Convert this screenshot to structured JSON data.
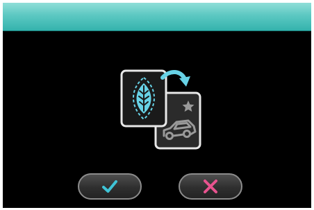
{
  "screen": {
    "title_bar_color": "#4cc1bb",
    "background_color": "#000000"
  },
  "graphic": {
    "front_card_icon": "leaf-icon",
    "back_card_icons": [
      "star-icon",
      "car-icon"
    ],
    "arrow_icon": "curved-arrow-icon",
    "accent_color": "#67d2e6"
  },
  "buttons": {
    "confirm": {
      "icon": "check-icon",
      "color": "#3fc3d6"
    },
    "cancel": {
      "icon": "x-icon",
      "color": "#e8538f"
    }
  }
}
